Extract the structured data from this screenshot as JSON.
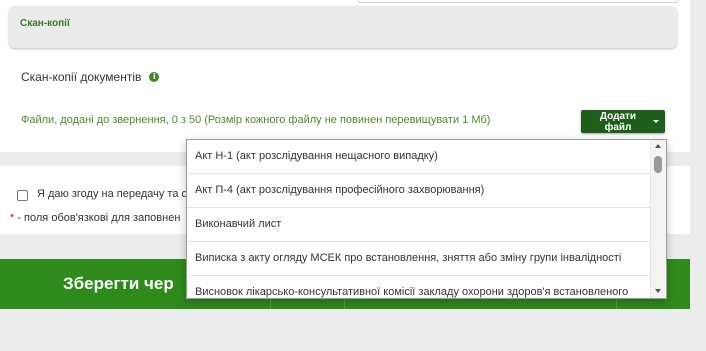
{
  "section": {
    "title": "Скан-копії"
  },
  "scans": {
    "label": "Скан-копії документів",
    "info_icon": "i",
    "files_info": "Файли, додані до звернення, 0 з 50 (Розмір кожного файлу не повинен перевищувати 1 Мб)",
    "add_file_label": "Додати файл"
  },
  "dropdown": {
    "items": [
      "Акт Н-1 (акт розслідування нещасного випадку)",
      "Акт П-4 (акт розслідування професійного захворювання)",
      "Виконавчий лист",
      "Виписка з акту огляду МСЕК про встановлення, зняття або зміну групи інвалідності",
      "Висновок лікарсько-консультативної комісії закладу охорони здоров'я встановленого"
    ]
  },
  "consent": {
    "text": "Я даю згоду на передачу та об",
    "required_star": "*",
    "required_note": " - поля обов'язкові для заповнен"
  },
  "save": {
    "label": "Зберегти чер"
  },
  "colors": {
    "accent_green": "#2f8a1c",
    "button_dark_green": "#1e5e1a",
    "text_green": "#4e8a2a",
    "required_red": "#d0021b"
  }
}
